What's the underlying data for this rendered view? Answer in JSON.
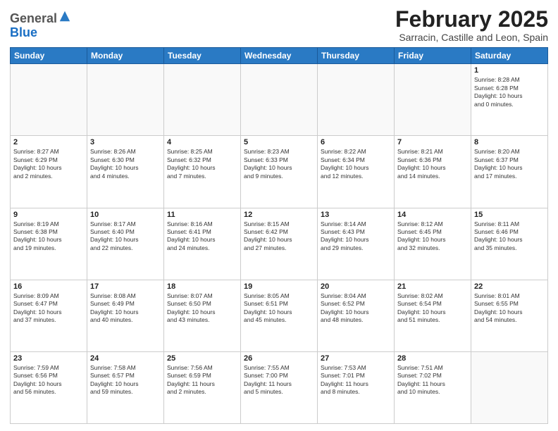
{
  "header": {
    "logo_general": "General",
    "logo_blue": "Blue",
    "month_title": "February 2025",
    "location": "Sarracin, Castille and Leon, Spain"
  },
  "weekdays": [
    "Sunday",
    "Monday",
    "Tuesday",
    "Wednesday",
    "Thursday",
    "Friday",
    "Saturday"
  ],
  "weeks": [
    [
      {
        "day": "",
        "info": ""
      },
      {
        "day": "",
        "info": ""
      },
      {
        "day": "",
        "info": ""
      },
      {
        "day": "",
        "info": ""
      },
      {
        "day": "",
        "info": ""
      },
      {
        "day": "",
        "info": ""
      },
      {
        "day": "1",
        "info": "Sunrise: 8:28 AM\nSunset: 6:28 PM\nDaylight: 10 hours\nand 0 minutes."
      }
    ],
    [
      {
        "day": "2",
        "info": "Sunrise: 8:27 AM\nSunset: 6:29 PM\nDaylight: 10 hours\nand 2 minutes."
      },
      {
        "day": "3",
        "info": "Sunrise: 8:26 AM\nSunset: 6:30 PM\nDaylight: 10 hours\nand 4 minutes."
      },
      {
        "day": "4",
        "info": "Sunrise: 8:25 AM\nSunset: 6:32 PM\nDaylight: 10 hours\nand 7 minutes."
      },
      {
        "day": "5",
        "info": "Sunrise: 8:23 AM\nSunset: 6:33 PM\nDaylight: 10 hours\nand 9 minutes."
      },
      {
        "day": "6",
        "info": "Sunrise: 8:22 AM\nSunset: 6:34 PM\nDaylight: 10 hours\nand 12 minutes."
      },
      {
        "day": "7",
        "info": "Sunrise: 8:21 AM\nSunset: 6:36 PM\nDaylight: 10 hours\nand 14 minutes."
      },
      {
        "day": "8",
        "info": "Sunrise: 8:20 AM\nSunset: 6:37 PM\nDaylight: 10 hours\nand 17 minutes."
      }
    ],
    [
      {
        "day": "9",
        "info": "Sunrise: 8:19 AM\nSunset: 6:38 PM\nDaylight: 10 hours\nand 19 minutes."
      },
      {
        "day": "10",
        "info": "Sunrise: 8:17 AM\nSunset: 6:40 PM\nDaylight: 10 hours\nand 22 minutes."
      },
      {
        "day": "11",
        "info": "Sunrise: 8:16 AM\nSunset: 6:41 PM\nDaylight: 10 hours\nand 24 minutes."
      },
      {
        "day": "12",
        "info": "Sunrise: 8:15 AM\nSunset: 6:42 PM\nDaylight: 10 hours\nand 27 minutes."
      },
      {
        "day": "13",
        "info": "Sunrise: 8:14 AM\nSunset: 6:43 PM\nDaylight: 10 hours\nand 29 minutes."
      },
      {
        "day": "14",
        "info": "Sunrise: 8:12 AM\nSunset: 6:45 PM\nDaylight: 10 hours\nand 32 minutes."
      },
      {
        "day": "15",
        "info": "Sunrise: 8:11 AM\nSunset: 6:46 PM\nDaylight: 10 hours\nand 35 minutes."
      }
    ],
    [
      {
        "day": "16",
        "info": "Sunrise: 8:09 AM\nSunset: 6:47 PM\nDaylight: 10 hours\nand 37 minutes."
      },
      {
        "day": "17",
        "info": "Sunrise: 8:08 AM\nSunset: 6:49 PM\nDaylight: 10 hours\nand 40 minutes."
      },
      {
        "day": "18",
        "info": "Sunrise: 8:07 AM\nSunset: 6:50 PM\nDaylight: 10 hours\nand 43 minutes."
      },
      {
        "day": "19",
        "info": "Sunrise: 8:05 AM\nSunset: 6:51 PM\nDaylight: 10 hours\nand 45 minutes."
      },
      {
        "day": "20",
        "info": "Sunrise: 8:04 AM\nSunset: 6:52 PM\nDaylight: 10 hours\nand 48 minutes."
      },
      {
        "day": "21",
        "info": "Sunrise: 8:02 AM\nSunset: 6:54 PM\nDaylight: 10 hours\nand 51 minutes."
      },
      {
        "day": "22",
        "info": "Sunrise: 8:01 AM\nSunset: 6:55 PM\nDaylight: 10 hours\nand 54 minutes."
      }
    ],
    [
      {
        "day": "23",
        "info": "Sunrise: 7:59 AM\nSunset: 6:56 PM\nDaylight: 10 hours\nand 56 minutes."
      },
      {
        "day": "24",
        "info": "Sunrise: 7:58 AM\nSunset: 6:57 PM\nDaylight: 10 hours\nand 59 minutes."
      },
      {
        "day": "25",
        "info": "Sunrise: 7:56 AM\nSunset: 6:59 PM\nDaylight: 11 hours\nand 2 minutes."
      },
      {
        "day": "26",
        "info": "Sunrise: 7:55 AM\nSunset: 7:00 PM\nDaylight: 11 hours\nand 5 minutes."
      },
      {
        "day": "27",
        "info": "Sunrise: 7:53 AM\nSunset: 7:01 PM\nDaylight: 11 hours\nand 8 minutes."
      },
      {
        "day": "28",
        "info": "Sunrise: 7:51 AM\nSunset: 7:02 PM\nDaylight: 11 hours\nand 10 minutes."
      },
      {
        "day": "",
        "info": ""
      }
    ]
  ]
}
